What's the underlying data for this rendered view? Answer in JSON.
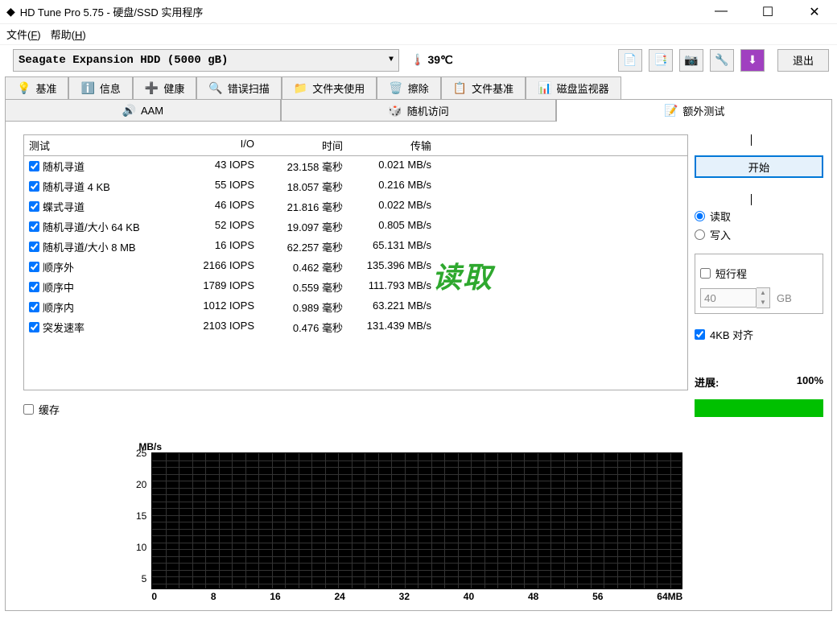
{
  "window": {
    "title": "HD Tune Pro 5.75 - 硬盘/SSD 实用程序",
    "min": "—",
    "max": "☐",
    "close": "✕"
  },
  "menu": {
    "file": "文件(F)",
    "help": "帮助(H)"
  },
  "toolbar": {
    "drive": "Seagate Expansion HDD (5000 gB)",
    "temp": "39℃",
    "exit": "退出"
  },
  "tabs1": [
    {
      "icon": "💡",
      "label": "基准"
    },
    {
      "icon": "ℹ️",
      "label": "信息"
    },
    {
      "icon": "➕",
      "label": "健康"
    },
    {
      "icon": "🔍",
      "label": "错误扫描"
    },
    {
      "icon": "📁",
      "label": "文件夹使用"
    },
    {
      "icon": "🗑️",
      "label": "擦除"
    },
    {
      "icon": "📋",
      "label": "文件基准"
    },
    {
      "icon": "📊",
      "label": "磁盘监视器"
    }
  ],
  "tabs2": [
    {
      "icon": "🔊",
      "label": "AAM"
    },
    {
      "icon": "🎲",
      "label": "随机访问"
    },
    {
      "icon": "📝",
      "label": "额外测试"
    }
  ],
  "table": {
    "hdr": {
      "test": "测试",
      "io": "I/O",
      "time": "时间",
      "xfer": "传输"
    },
    "rows": [
      {
        "test": "随机寻道",
        "io": "43 IOPS",
        "time": "23.158 毫秒",
        "xfer": "0.021 MB/s"
      },
      {
        "test": "随机寻道 4 KB",
        "io": "55 IOPS",
        "time": "18.057 毫秒",
        "xfer": "0.216 MB/s"
      },
      {
        "test": "蝶式寻道",
        "io": "46 IOPS",
        "time": "21.816 毫秒",
        "xfer": "0.022 MB/s"
      },
      {
        "test": "随机寻道/大小 64 KB",
        "io": "52 IOPS",
        "time": "19.097 毫秒",
        "xfer": "0.805 MB/s"
      },
      {
        "test": "随机寻道/大小 8 MB",
        "io": "16 IOPS",
        "time": "62.257 毫秒",
        "xfer": "65.131 MB/s"
      },
      {
        "test": "顺序外",
        "io": "2166 IOPS",
        "time": "0.462 毫秒",
        "xfer": "135.396 MB/s"
      },
      {
        "test": "顺序中",
        "io": "1789 IOPS",
        "time": "0.559 毫秒",
        "xfer": "111.793 MB/s"
      },
      {
        "test": "顺序内",
        "io": "1012 IOPS",
        "time": "0.989 毫秒",
        "xfer": "63.221 MB/s"
      },
      {
        "test": "突发速率",
        "io": "2103 IOPS",
        "time": "0.476 毫秒",
        "xfer": "131.439 MB/s"
      }
    ]
  },
  "cache": "缓存",
  "watermark": "读取",
  "right": {
    "start": "开始",
    "read": "读取",
    "write": "写入",
    "short": "短行程",
    "short_val": "40",
    "gb": "GB",
    "align": "4KB 对齐",
    "progress_label": "进展:",
    "progress_pct": "100%"
  },
  "chart_data": {
    "type": "line",
    "title": "",
    "yunit": "MB/s",
    "xunit": "MB",
    "yticks": [
      5,
      10,
      15,
      20,
      25
    ],
    "xticks": [
      0,
      8,
      16,
      24,
      32,
      40,
      48,
      56,
      "64MB"
    ],
    "ylim": [
      0,
      25
    ],
    "xlim": [
      0,
      64
    ],
    "series": []
  }
}
